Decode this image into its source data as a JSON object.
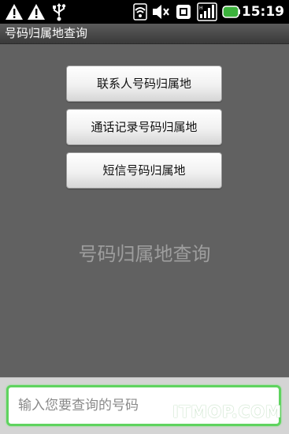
{
  "status_bar": {
    "time": "15:19",
    "icons": [
      "warning-icon",
      "warning-icon",
      "usb-icon",
      "wifi-icon",
      "mute-icon",
      "sim-icon",
      "signal-icon",
      "battery-icon"
    ],
    "battery_color": "#4cd137"
  },
  "app": {
    "title": "号码归属地查询"
  },
  "buttons": {
    "contacts": "联系人号码归属地",
    "call_log": "通话记录号码归属地",
    "sms": "短信号码归属地"
  },
  "center_title": "号码归属地查询",
  "input": {
    "value": "",
    "placeholder": "输入您要查询的号码"
  },
  "watermark": "ITMOP.COM",
  "colors": {
    "background": "#616161",
    "input_focus": "#5fd35f"
  }
}
